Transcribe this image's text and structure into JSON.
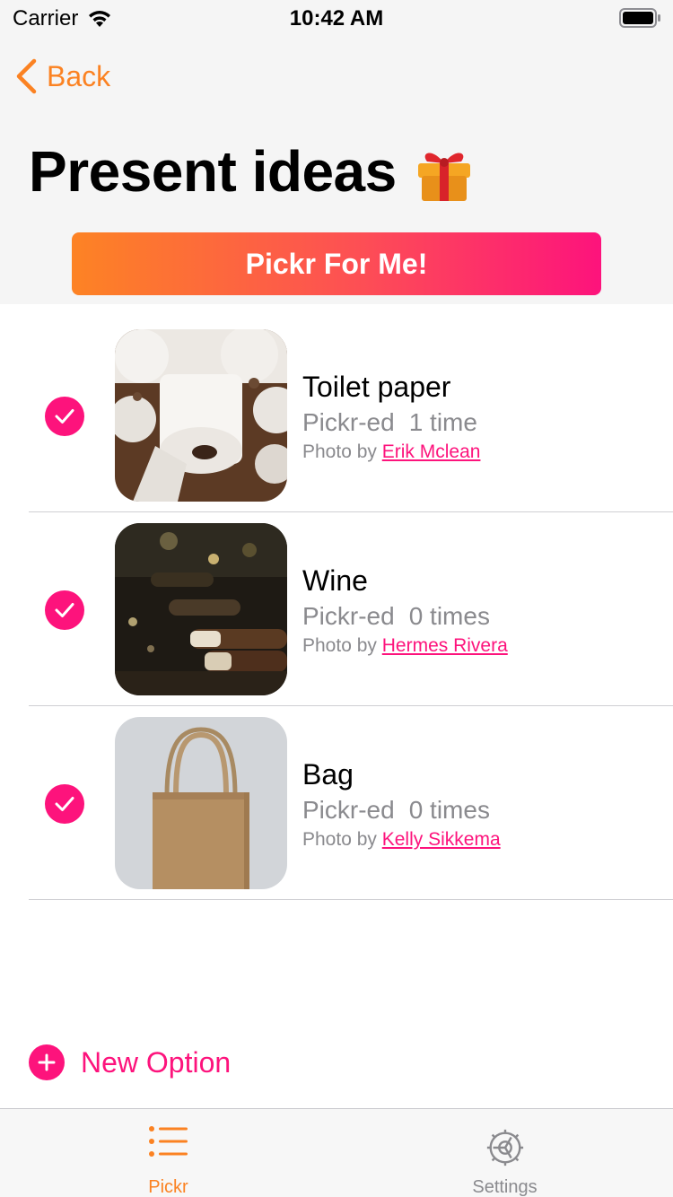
{
  "status_bar": {
    "carrier": "Carrier",
    "time": "10:42 AM"
  },
  "nav": {
    "back_label": "Back"
  },
  "page": {
    "title": "Present ideas",
    "title_emoji": "gift-icon"
  },
  "action": {
    "pickr_label": "Pickr For Me!"
  },
  "options": [
    {
      "name": "Toilet paper",
      "count_prefix": "Pickr-ed",
      "count_value": "1 time",
      "credit_prefix": "Photo by",
      "photographer": "Erik Mclean",
      "checked": true,
      "image": "toilet-paper-photo"
    },
    {
      "name": "Wine",
      "count_prefix": "Pickr-ed",
      "count_value": "0 times",
      "credit_prefix": "Photo by",
      "photographer": "Hermes Rivera",
      "checked": true,
      "image": "wine-bottles-photo"
    },
    {
      "name": "Bag",
      "count_prefix": "Pickr-ed",
      "count_value": "0 times",
      "credit_prefix": "Photo by",
      "photographer": "Kelly Sikkema",
      "checked": true,
      "image": "paper-bag-photo"
    }
  ],
  "new_option_label": "New Option",
  "tabs": [
    {
      "label": "Pickr",
      "icon": "list-icon",
      "active": true
    },
    {
      "label": "Settings",
      "icon": "gear-icon",
      "active": false
    }
  ],
  "colors": {
    "accent_orange": "#fb8222",
    "accent_pink": "#fd137c",
    "secondary_text": "#8a8a8e"
  }
}
